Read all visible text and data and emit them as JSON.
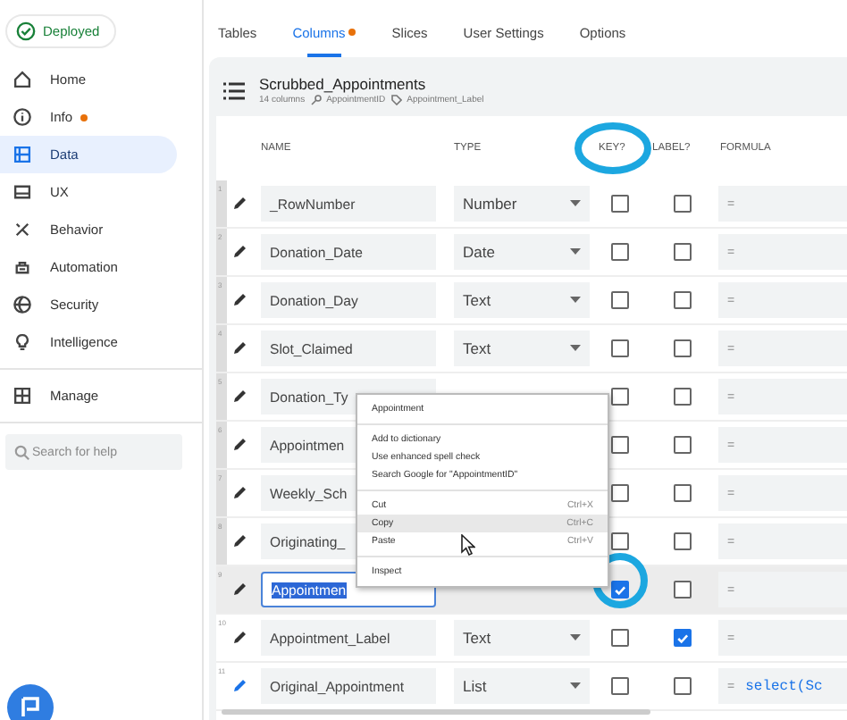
{
  "status": {
    "label": "Deployed"
  },
  "tabs": [
    {
      "label": "Tables",
      "selected": false,
      "badge": false
    },
    {
      "label": "Columns",
      "selected": true,
      "badge": true
    },
    {
      "label": "Slices",
      "selected": false,
      "badge": false
    },
    {
      "label": "User Settings",
      "selected": false,
      "badge": false
    },
    {
      "label": "Options",
      "selected": false,
      "badge": false
    }
  ],
  "sidebar": {
    "items": [
      {
        "label": "Home",
        "selected": false,
        "badge": false
      },
      {
        "label": "Info",
        "selected": false,
        "badge": true
      },
      {
        "label": "Data",
        "selected": true,
        "badge": false
      },
      {
        "label": "UX",
        "selected": false,
        "badge": false
      },
      {
        "label": "Behavior",
        "selected": false,
        "badge": false
      },
      {
        "label": "Automation",
        "selected": false,
        "badge": false
      },
      {
        "label": "Security",
        "selected": false,
        "badge": false
      },
      {
        "label": "Intelligence",
        "selected": false,
        "badge": false
      }
    ],
    "manage": {
      "label": "Manage"
    },
    "search": {
      "placeholder": "Search for help"
    }
  },
  "table_header": {
    "title": "Scrubbed_Appointments",
    "count": "14 columns",
    "key": "AppointmentID",
    "label": "Appointment_Label"
  },
  "columns": [
    {
      "label": "NAME",
      "circled": false
    },
    {
      "label": "TYPE",
      "circled": false
    },
    {
      "label": "KEY?",
      "circled": true
    },
    {
      "label": "LABEL?",
      "circled": false
    },
    {
      "label": "FORMULA",
      "circled": false
    }
  ],
  "rows": [
    {
      "number": "1",
      "name": "_RowNumber",
      "type": "Number",
      "key": false,
      "label": false,
      "formula": "=",
      "selected": false,
      "key_circled": false
    },
    {
      "number": "2",
      "name": "Donation_Date",
      "type": "Date",
      "key": false,
      "label": false,
      "formula": "=",
      "selected": false,
      "key_circled": false
    },
    {
      "number": "3",
      "name": "Donation_Day",
      "type": "Text",
      "key": false,
      "label": false,
      "formula": "=",
      "selected": false,
      "key_circled": false
    },
    {
      "number": "4",
      "name": "Slot_Claimed",
      "type": "Text",
      "key": false,
      "label": false,
      "formula": "=",
      "selected": false,
      "key_circled": false
    },
    {
      "number": "5",
      "name": "Donation_Ty",
      "key": false,
      "label": false,
      "formula": "=",
      "selected": false,
      "key_circled": false
    },
    {
      "number": "6",
      "name": "Appointmen",
      "key": false,
      "label": false,
      "formula": "=",
      "selected": false,
      "key_circled": false
    },
    {
      "number": "7",
      "name": "Weekly_Sch",
      "key": false,
      "label": false,
      "formula": "=",
      "selected": false,
      "key_circled": false
    },
    {
      "number": "8",
      "name": "Originating_",
      "key": false,
      "label": false,
      "formula": "=",
      "selected": false,
      "key_circled": false
    },
    {
      "number": "9",
      "name": "Appointmen",
      "key": true,
      "label": false,
      "formula": "=",
      "selected": true,
      "key_circled": true
    },
    {
      "number": "10",
      "name": "Appointment_Label",
      "type": "Text",
      "key": false,
      "label": true,
      "formula": "=",
      "selected": false,
      "key_circled": false
    },
    {
      "number": "11",
      "name": "Original_Appointment",
      "type": "List",
      "key": false,
      "label": false,
      "formula": "=",
      "expression": "select(Sc",
      "selected": false,
      "key_circled": false
    }
  ],
  "context_menu": {
    "items": [
      {
        "kind": "item",
        "label": "Appointment",
        "selected": false
      },
      {
        "kind": "divider"
      },
      {
        "kind": "item",
        "label": "Add to dictionary",
        "selected": false
      },
      {
        "kind": "item",
        "label": "Use enhanced spell check",
        "selected": false
      },
      {
        "kind": "item",
        "label": "Search Google for \"AppointmentID\"",
        "selected": false
      },
      {
        "kind": "divider"
      },
      {
        "kind": "item",
        "label": "Cut",
        "shortcut": "Ctrl+X",
        "selected": false
      },
      {
        "kind": "item",
        "label": "Copy",
        "shortcut": "Ctrl+C",
        "selected": true
      },
      {
        "kind": "item",
        "label": "Paste",
        "shortcut": "Ctrl+V",
        "selected": false
      },
      {
        "kind": "divider"
      },
      {
        "kind": "item",
        "label": "Inspect",
        "selected": false
      }
    ]
  }
}
